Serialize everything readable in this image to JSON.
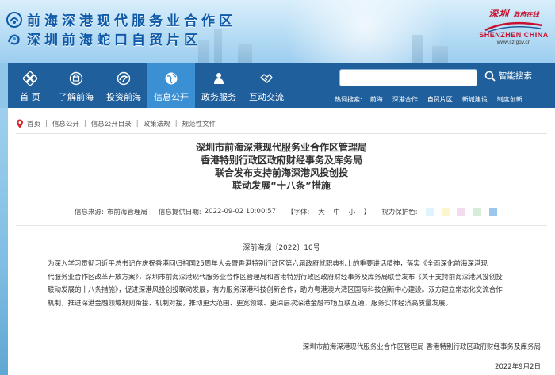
{
  "header": {
    "logo_line1": "前海深港现代服务业合作区",
    "logo_line2": "深圳前海蛇口自贸片区",
    "sz_logo_cn": "深圳",
    "sz_logo_cn_small": "政府在线",
    "sz_logo_en": "SHENZHEN CHINA",
    "sz_logo_url": "www.sz.gov.cn"
  },
  "nav": {
    "items": [
      {
        "label": "首 页",
        "icon": "home-grid-icon"
      },
      {
        "label": "了解前海",
        "icon": "emblem-icon"
      },
      {
        "label": "投资前海",
        "icon": "swirl-icon"
      },
      {
        "label": "信息公开",
        "icon": "globe-icon",
        "active": true
      },
      {
        "label": "政务服务",
        "icon": "person-icon"
      },
      {
        "label": "互动交流",
        "icon": "handshake-icon"
      }
    ],
    "search_button": "智能搜索",
    "hot_label": "热词搜索:",
    "hot_words": [
      "前海",
      "深港合作",
      "自贸片区",
      "新城建设",
      "制度创新"
    ]
  },
  "breadcrumb": [
    "首页",
    "信息公开",
    "信息公开目录",
    "政策法规",
    "规范性文件"
  ],
  "article": {
    "title_lines": [
      "深圳市前海深港现代服务业合作区管理局",
      "香港特别行政区政府财经事务及库务局",
      "联合发布支持前海深港风投创投",
      "联动发展“十八条”措施"
    ],
    "meta": {
      "source_label": "信息来源:",
      "source": "市前海管理局",
      "date_label": "信息提供日期:",
      "date": "2022-09-02 10:00:57",
      "font_label": "【字体:",
      "font_sizes": [
        "大",
        "中",
        "小"
      ],
      "font_end": "】",
      "eye_label": "视力保护色:",
      "eye_colors": [
        "#dff4fb",
        "#fbf6cf",
        "#f3dcef",
        "#d9ecda",
        "#9cc7ec"
      ]
    },
    "doc_number": "深前海规〔2022〕10号",
    "paragraph_lines": [
      "为深入学习贯彻习近平总书记在庆祝香港回归祖国25周年大会暨香港特别行政区第六届政府就职典礼上的重要讲话精神，落实《全面深化前海深港现",
      "代服务业合作区改革开放方案》，深圳市前海深港现代服务业合作区管理局和香港特别行政区政府财经事务及库务局联合发布《关于支持前海深港风投创投",
      "联动发展的十八条措施》，促进深港风投创投联动发展，有力服务深港科技创新合作，助力粤港澳大湾区国际科技创新中心建设。双方建立常态化交流合作",
      "机制，推进深港金融领域规则衔接、机制对接，推动更大范围、更宽领域、更深层次深港金融市场互联互通，服务实体经济高质量发展。"
    ],
    "signature": "深圳市前海深港现代服务业合作区管理局   香港特别行政区政府财经事务及库务局",
    "sign_date": "2022年9月2日"
  },
  "colors": {
    "nav_bg": "#1f5f9c",
    "nav_active": "#3b8fd3",
    "logo_blue": "#0f5aa8",
    "sz_red": "#c8102e"
  }
}
